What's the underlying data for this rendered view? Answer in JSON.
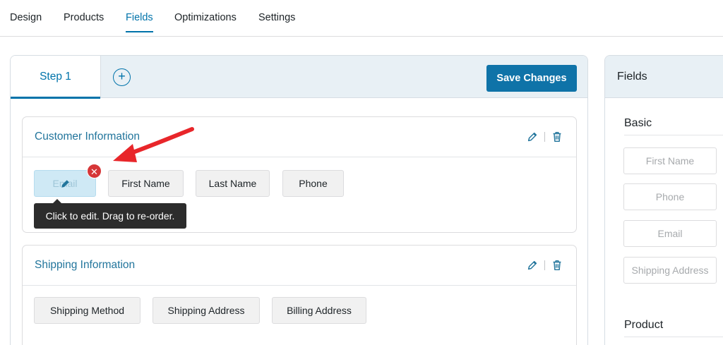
{
  "topnav": {
    "tabs": [
      {
        "label": "Design"
      },
      {
        "label": "Products"
      },
      {
        "label": "Fields"
      },
      {
        "label": "Optimizations"
      },
      {
        "label": "Settings"
      }
    ],
    "active_tab": "Fields"
  },
  "editor": {
    "step_label": "Step 1",
    "add_step_symbol": "+",
    "save_label": "Save Changes",
    "sections": [
      {
        "title": "Customer Information",
        "fields": [
          "Email",
          "First Name",
          "Last Name",
          "Phone"
        ]
      },
      {
        "title": "Shipping Information",
        "fields": [
          "Shipping Method",
          "Shipping Address",
          "Billing Address"
        ]
      }
    ],
    "remove_symbol": "✕",
    "tooltip": "Click to edit. Drag to re-order."
  },
  "sidebar": {
    "title": "Fields",
    "groups": [
      {
        "label": "Basic",
        "fields": [
          "First Name",
          "Phone",
          "Email",
          "Shipping Address"
        ]
      },
      {
        "label": "Product"
      }
    ]
  },
  "colors": {
    "accent": "#0073aa",
    "remove": "#d63638",
    "annotation_arrow": "#e8262a"
  }
}
